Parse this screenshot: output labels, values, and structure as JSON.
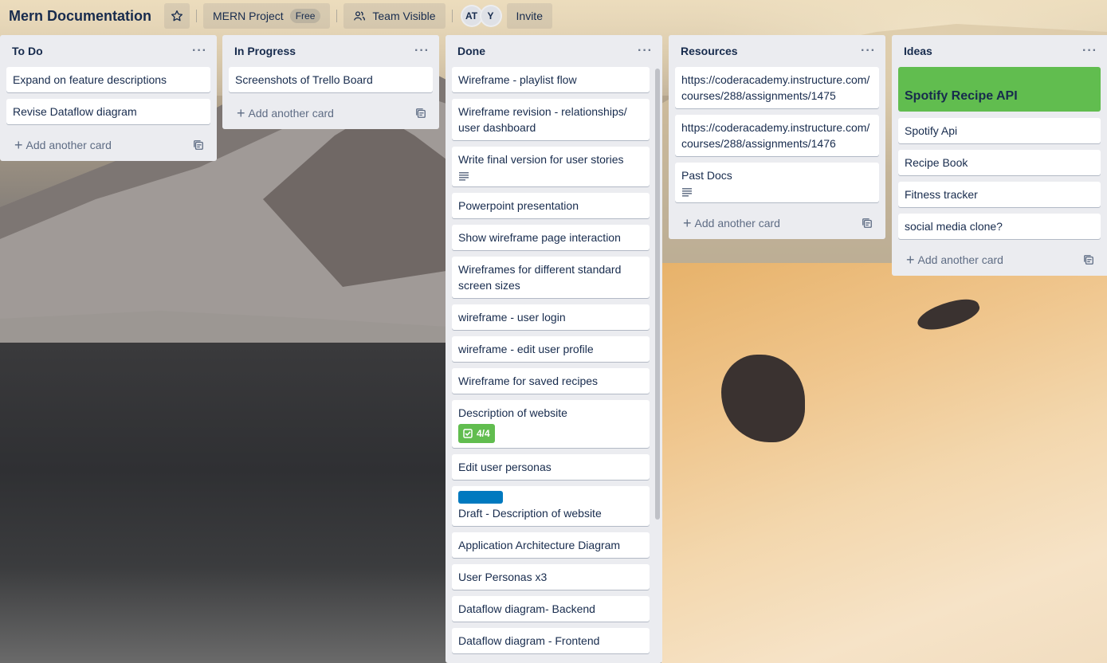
{
  "header": {
    "board_title": "Mern Documentation",
    "workspace_label": "MERN Project",
    "workspace_badge": "Free",
    "visibility_label": "Team Visible",
    "avatars": [
      "AT",
      "Y"
    ],
    "invite_label": "Invite"
  },
  "lists": [
    {
      "title": "To Do",
      "cards": [
        {
          "text": "Expand on feature descriptions"
        },
        {
          "text": "Revise Dataflow diagram"
        }
      ],
      "add_label": "Add another card"
    },
    {
      "title": "In Progress",
      "cards": [
        {
          "text": "Screenshots of Trello Board"
        }
      ],
      "add_label": "Add another card"
    },
    {
      "title": "Done",
      "cards": [
        {
          "text": "Wireframe - playlist flow"
        },
        {
          "text": "Wireframe revision - relationships/ user dashboard"
        },
        {
          "text": "Write final version for user stories"
        },
        {
          "text": "Powerpoint presentation"
        },
        {
          "text": "Show wireframe page interaction"
        },
        {
          "text": "Wireframes for different standard screen sizes"
        },
        {
          "text": "wireframe - user login"
        },
        {
          "text": "wireframe - edit user profile"
        },
        {
          "text": "Wireframe for saved recipes"
        },
        {
          "text": "Description of website",
          "checklist": "4/4"
        },
        {
          "text": "Edit user personas"
        },
        {
          "text": "Draft - Description of website"
        },
        {
          "text": "Application Architecture Diagram"
        },
        {
          "text": "User Personas x3"
        },
        {
          "text": "Dataflow diagram- Backend"
        },
        {
          "text": "Dataflow diagram - Frontend"
        }
      ]
    },
    {
      "title": "Resources",
      "cards": [
        {
          "text": "https://coderacademy.instructure.com/courses/288/assignments/1475"
        },
        {
          "text": "https://coderacademy.instructure.com/courses/288/assignments/1476"
        },
        {
          "text": "Past Docs"
        }
      ],
      "add_label": "Add another card"
    },
    {
      "title": "Ideas",
      "cover_card": "Spotify Recipe API",
      "cards": [
        {
          "text": "Spotify Api"
        },
        {
          "text": "Recipe Book"
        },
        {
          "text": "Fitness tracker"
        },
        {
          "text": "social media clone?"
        }
      ],
      "add_label": "Add another card"
    }
  ],
  "colors": {
    "list_bg": "#ebecf0",
    "card_bg": "#ffffff",
    "green_label": "#61bd4f",
    "blue_label": "#0079bf",
    "text": "#172b4d",
    "muted": "#5e6c84"
  }
}
